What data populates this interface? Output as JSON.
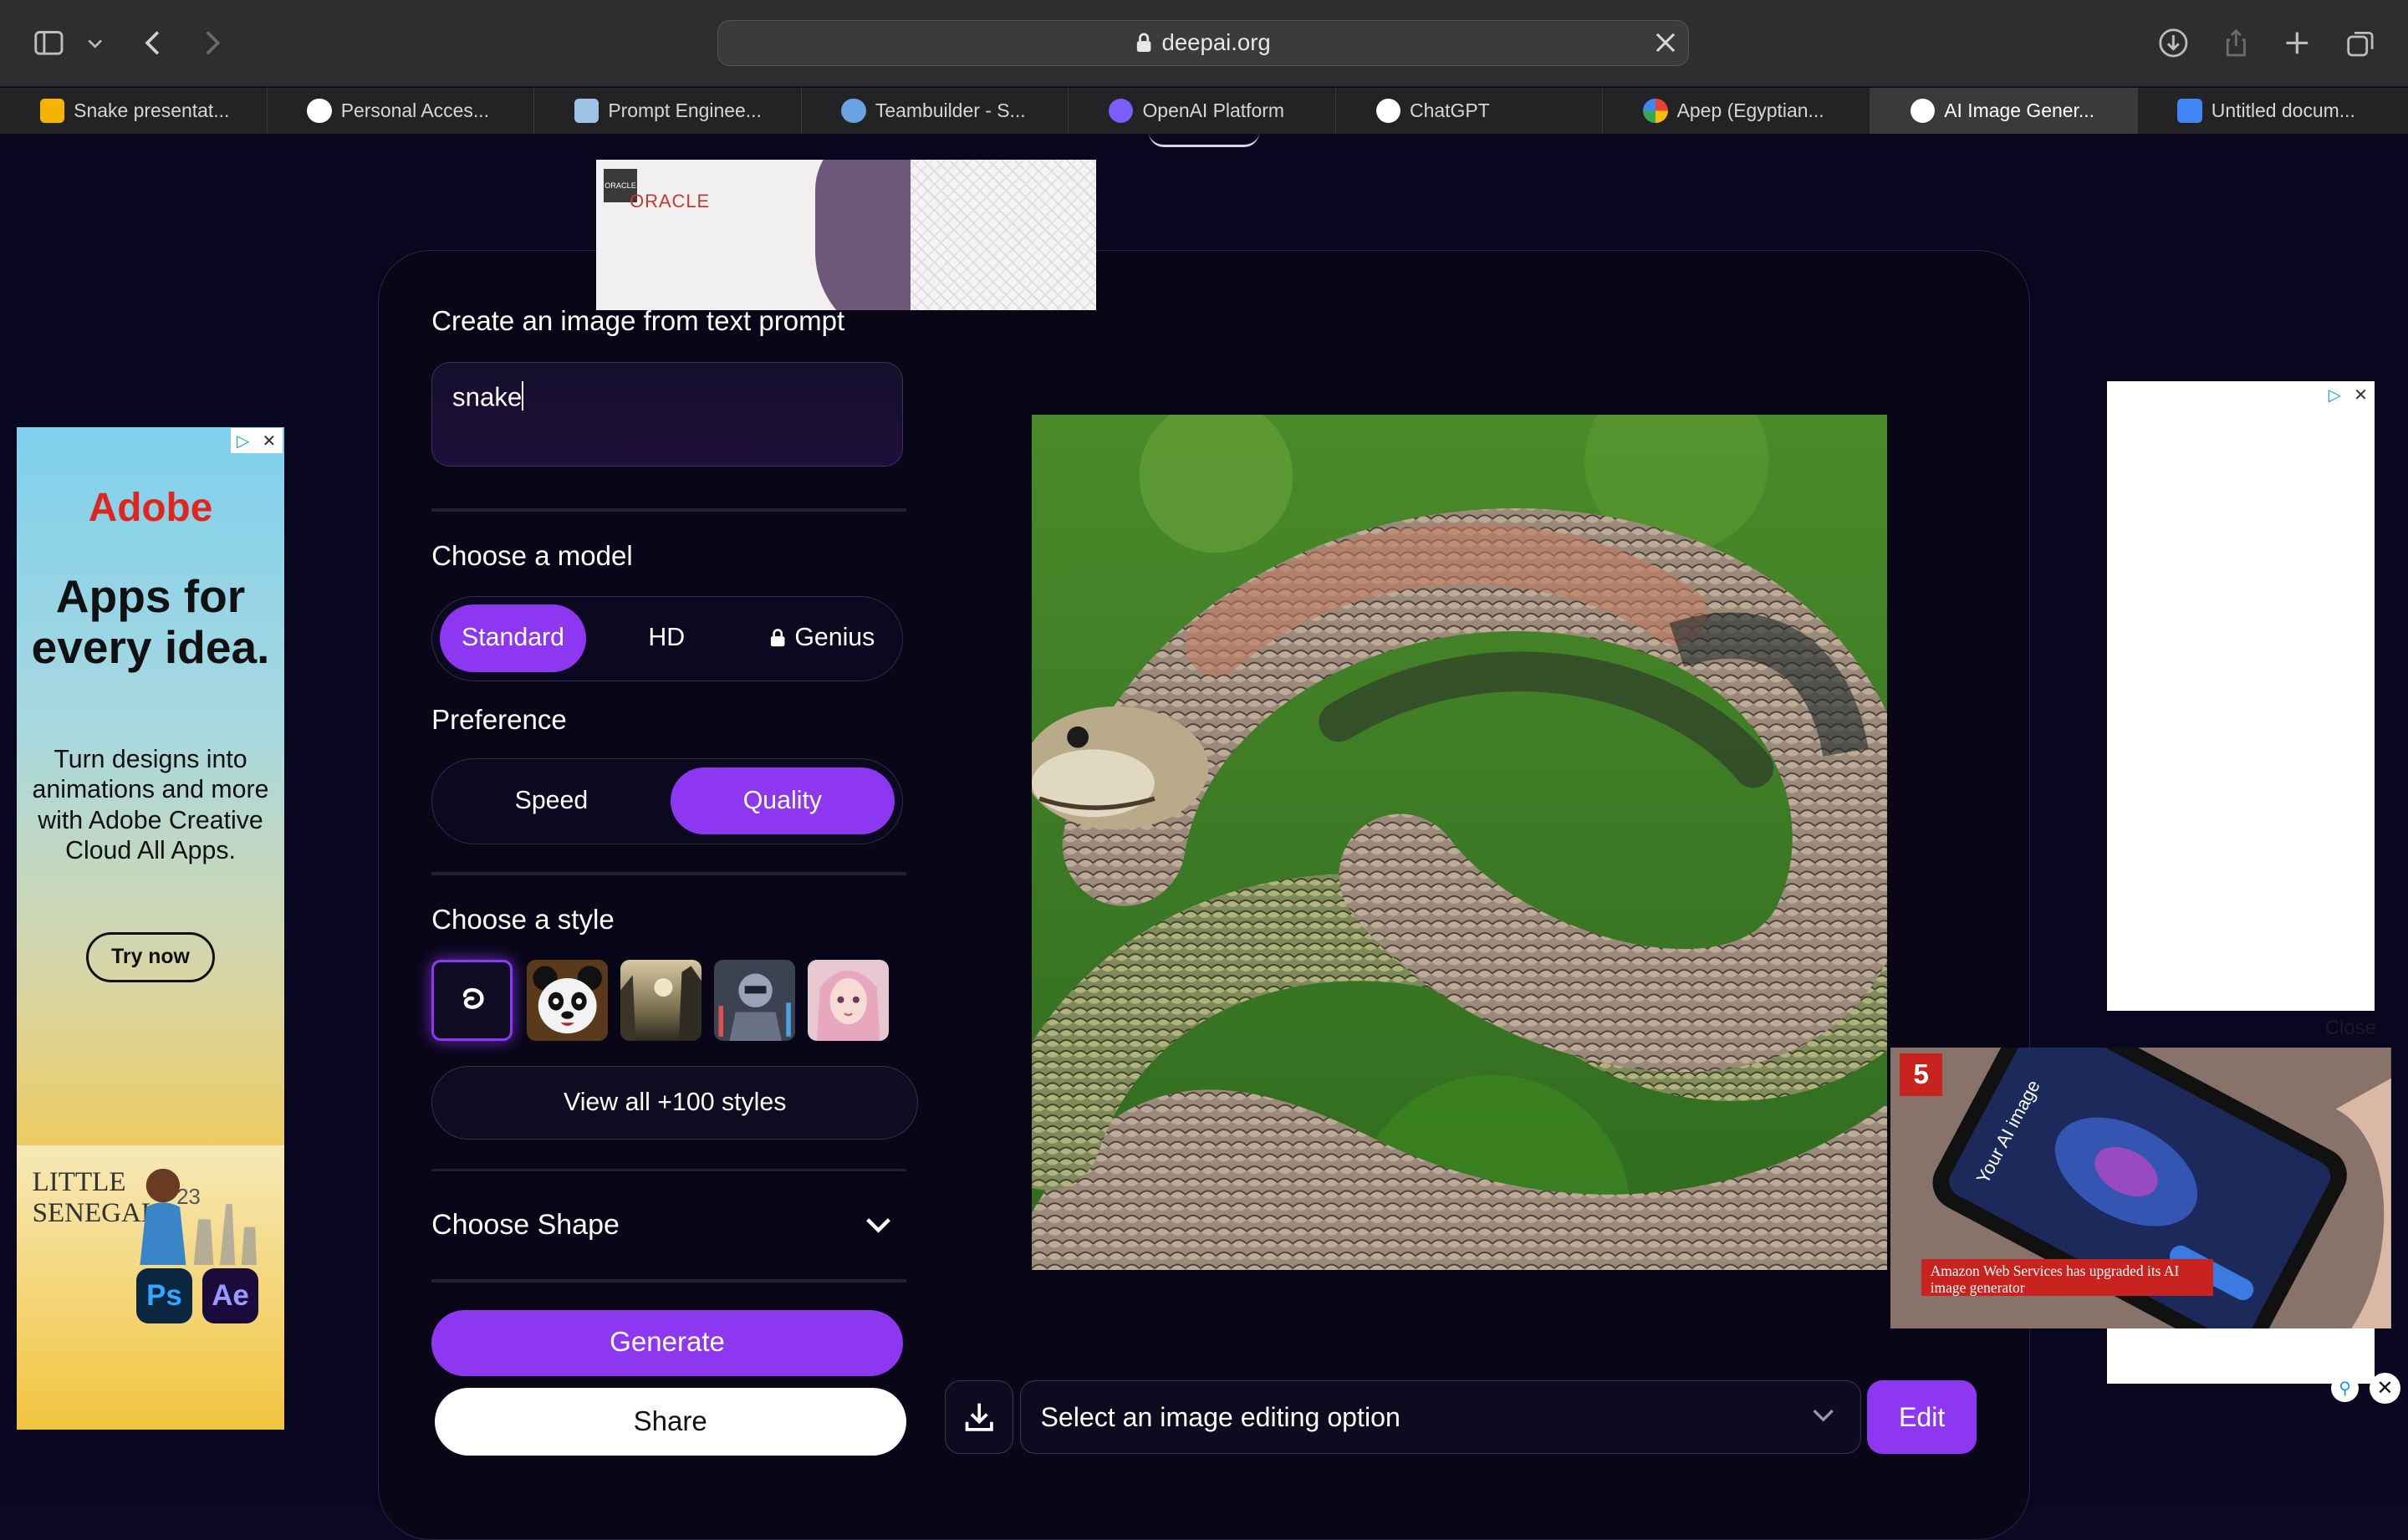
{
  "browser": {
    "url": "deepai.org",
    "tabs": [
      {
        "label": "Snake presentat...",
        "color": "#f4b400"
      },
      {
        "label": "Personal Acces...",
        "color": "#ffffff"
      },
      {
        "label": "Prompt Enginee...",
        "color": "#9ec2e6"
      },
      {
        "label": "Teambuilder - S...",
        "color": "#6aa1e0"
      },
      {
        "label": "OpenAI Platform",
        "color": "#7b5cff"
      },
      {
        "label": "ChatGPT",
        "color": "#ffffff"
      },
      {
        "label": "Apep (Egyptian...",
        "color": "#4285f4"
      },
      {
        "label": "AI Image Gener...",
        "color": "#ffffff"
      },
      {
        "label": "Untitled docum...",
        "color": "#4285f4"
      }
    ],
    "active_tab_index": 7
  },
  "oracle_ad": {
    "badge": "ORACLE",
    "logo": "ORACLE"
  },
  "form": {
    "prompt_label": "Create an image from text prompt",
    "prompt_value": "snake",
    "model_label": "Choose a model",
    "models": [
      "Standard",
      "HD",
      "Genius"
    ],
    "model_selected": "Standard",
    "preference_label": "Preference",
    "preferences": [
      "Speed",
      "Quality"
    ],
    "preference_selected": "Quality",
    "style_label": "Choose a style",
    "styles": [
      "default-swirl",
      "panda",
      "fantasy-landscape",
      "cyber-robot",
      "anime-portrait"
    ],
    "view_all_label": "View all +100 styles",
    "shape_label": "Choose Shape",
    "generate_label": "Generate",
    "share_label": "Share"
  },
  "result": {
    "image_icon": "generated-snake-image",
    "edit_placeholder": "Select an image editing option",
    "edit_label": "Edit"
  },
  "ads": {
    "adobe_brand": "Adobe",
    "adobe_headline": "Apps for every idea.",
    "adobe_sub": "Turn designs into animations and more with Adobe Creative Cloud All Apps.",
    "adobe_cta": "Try now",
    "adobe_little": "LITTLE SENEGAL",
    "adobe_year": "23",
    "ps": "Ps",
    "ae": "Ae",
    "video_close": "Close",
    "video_caption": "Amazon Web Services has upgraded its AI image generator",
    "video_logo": "5",
    "video_phone_title": "Your AI image"
  },
  "colors": {
    "accent": "#8d38f0",
    "background": "#0a0822"
  }
}
